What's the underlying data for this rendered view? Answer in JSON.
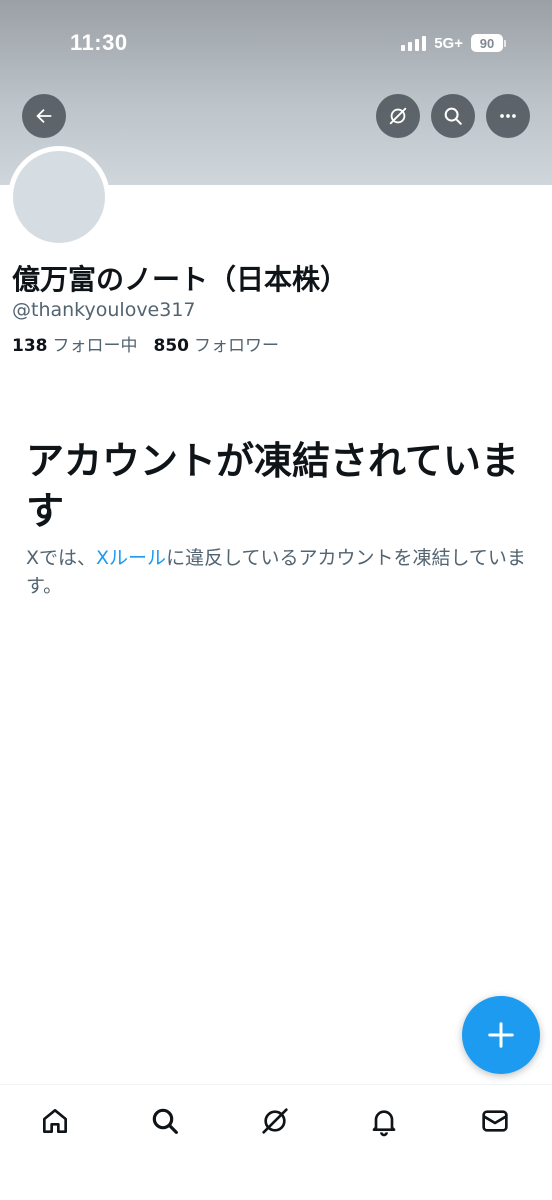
{
  "status_bar": {
    "time": "11:30",
    "network": "5G+",
    "battery": "90"
  },
  "header": {
    "back_icon": "arrow-left-icon",
    "grok_icon": "grok-icon",
    "search_icon": "search-icon",
    "more_icon": "more-horizontal-icon"
  },
  "profile": {
    "display_name": "億万富のノート（日本株）",
    "handle": "@thankyoulove317",
    "following_count": "138",
    "following_label": "フォロー中",
    "followers_count": "850",
    "followers_label": "フォロワー"
  },
  "suspended": {
    "title": "アカウントが凍結されています",
    "desc_prefix": "Xでは、",
    "rules_link": "Xルール",
    "desc_suffix": "に違反しているアカウントを凍結しています。"
  },
  "fab": {
    "icon": "plus-icon"
  },
  "bottom_nav": [
    {
      "icon": "home-icon"
    },
    {
      "icon": "search-icon"
    },
    {
      "icon": "grok-icon"
    },
    {
      "icon": "bell-icon"
    },
    {
      "icon": "mail-icon"
    }
  ],
  "colors": {
    "accent": "#1d9bf0",
    "text_primary": "#0f1419",
    "text_secondary": "#536471"
  }
}
